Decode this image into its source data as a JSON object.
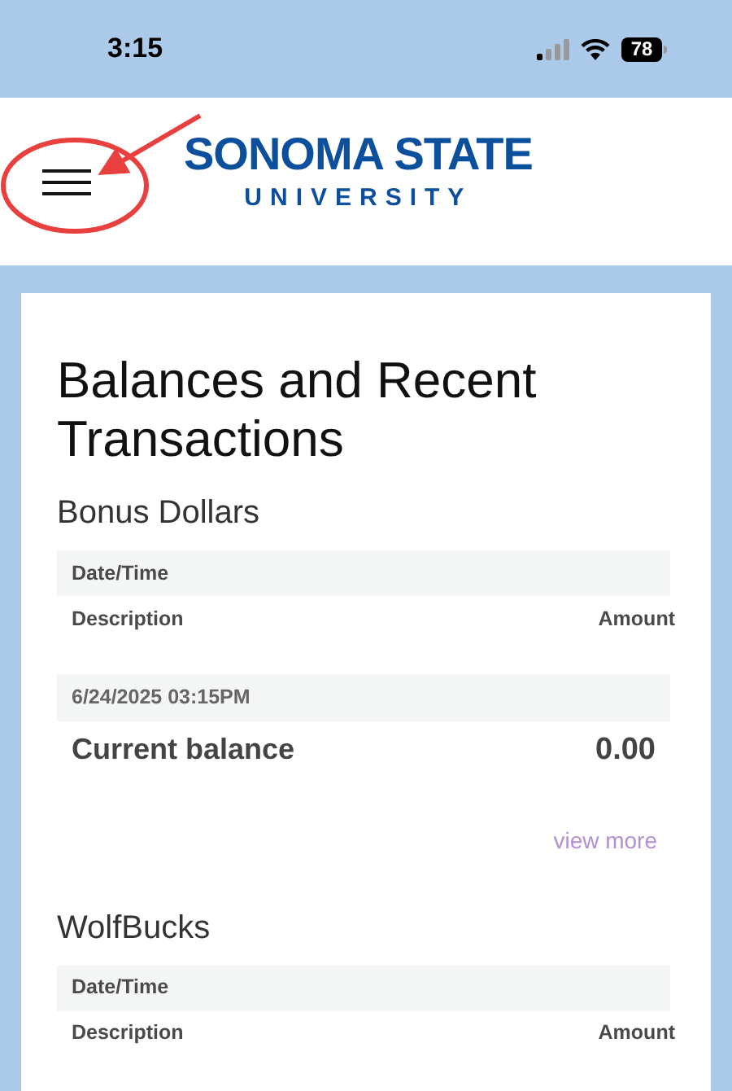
{
  "status_bar": {
    "time": "3:15",
    "battery": "78"
  },
  "header": {
    "logo_line_1": "SONOMA STATE",
    "logo_line_2": "UNIVERSITY",
    "annotation": {
      "kind": "circle-arrow"
    }
  },
  "title": "Balances and Recent Transactions",
  "accounts": [
    {
      "name": "Bonus Dollars",
      "columns": {
        "date": "Date/Time",
        "description": "Description",
        "amount": "Amount"
      },
      "transactions": [
        {
          "date": "6/24/2025 03:15PM",
          "description": "Current balance",
          "amount": "0.00"
        }
      ],
      "link": "view more"
    },
    {
      "name": "WolfBucks",
      "columns": {
        "date": "Date/Time",
        "description": "Description",
        "amount": "Amount"
      }
    }
  ]
}
